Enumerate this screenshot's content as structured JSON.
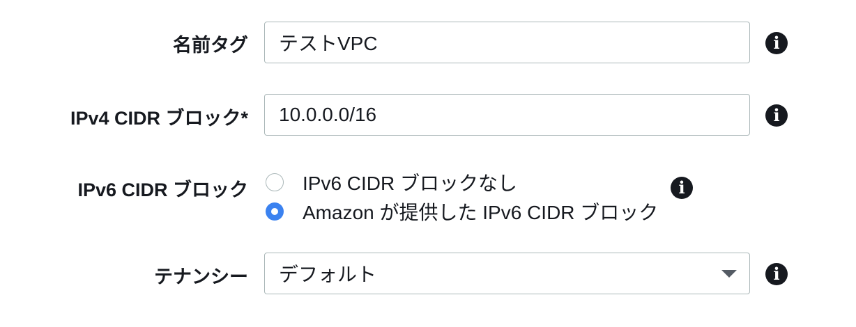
{
  "form": {
    "name_tag": {
      "label": "名前タグ",
      "value": "テストVPC"
    },
    "ipv4_cidr": {
      "label": "IPv4 CIDR ブロック*",
      "value": "10.0.0.0/16"
    },
    "ipv6_cidr": {
      "label": "IPv6 CIDR ブロック",
      "options": [
        {
          "label": "IPv6 CIDR ブロックなし",
          "selected": false
        },
        {
          "label": "Amazon が提供した IPv6 CIDR ブロック",
          "selected": true
        }
      ]
    },
    "tenancy": {
      "label": "テナンシー",
      "value": "デフォルト"
    }
  },
  "icons": {
    "info": "i",
    "info_color": "#16191f"
  },
  "colors": {
    "radio_selected": "#3b82f0",
    "field_border": "#aab7b8",
    "text": "#16191f"
  }
}
